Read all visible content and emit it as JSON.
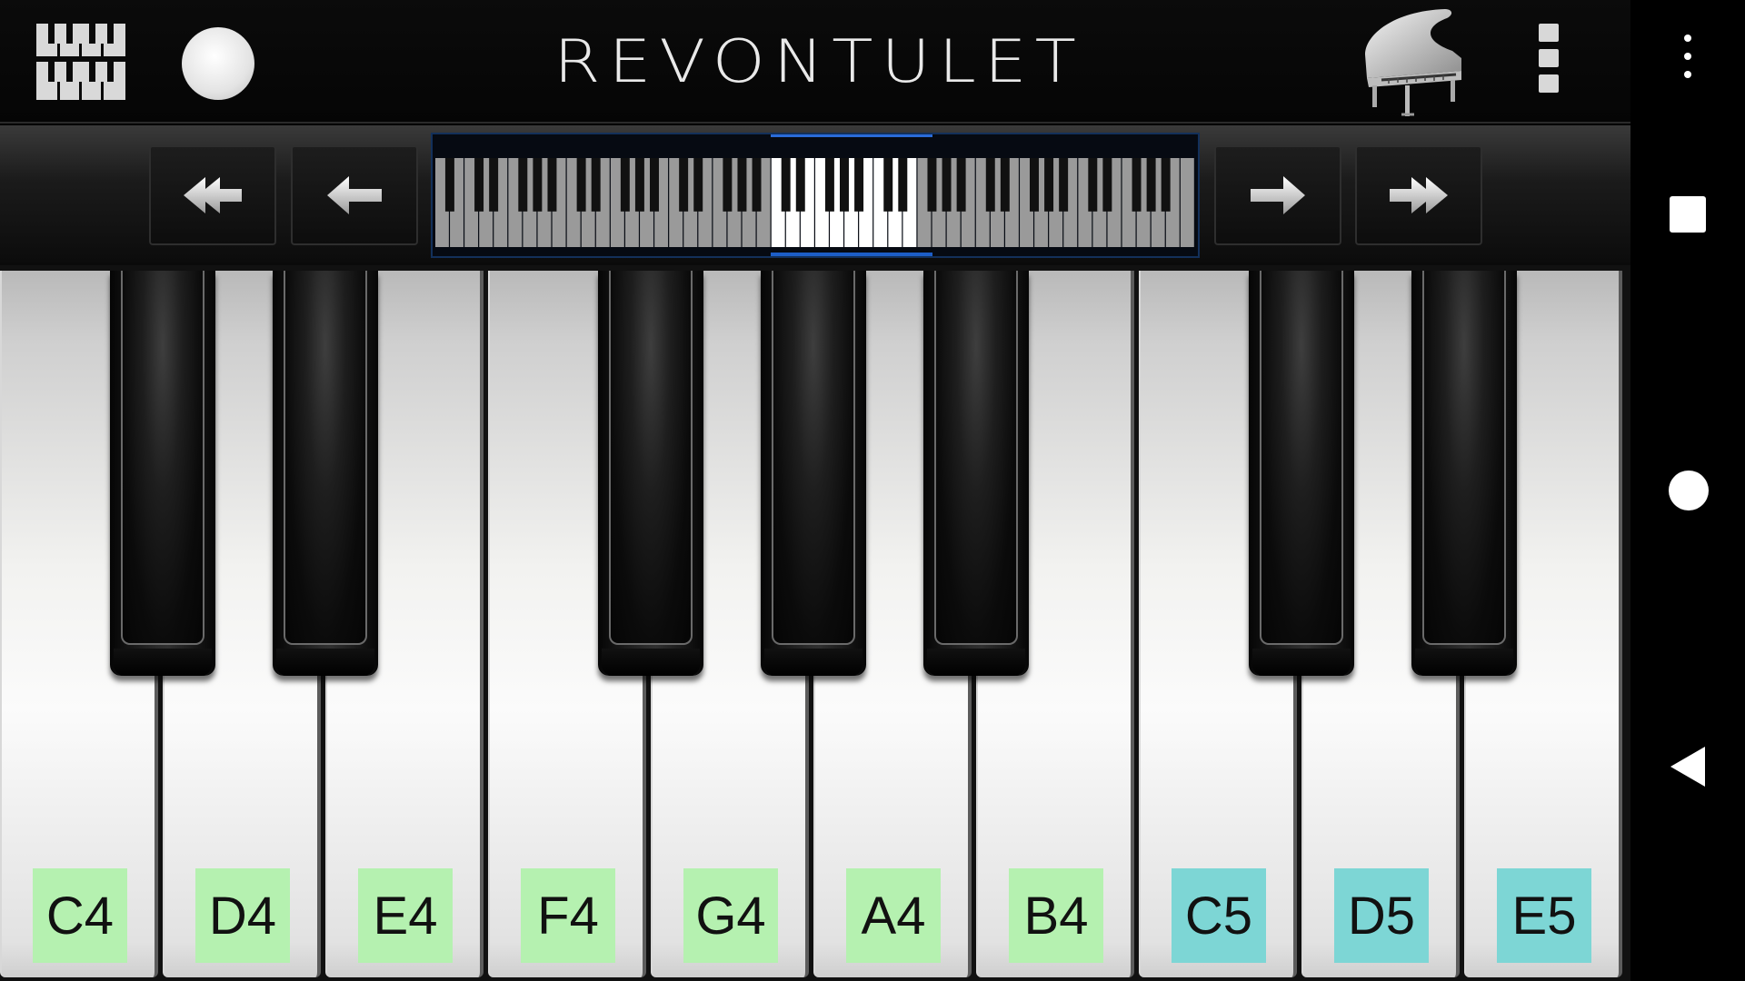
{
  "app": {
    "title": "REVONTULET"
  },
  "toolbar": {
    "left_icon": "keyboard-layout-icon",
    "record_icon": "record-icon",
    "instrument_icon": "grand-piano-icon",
    "menu_icon": "vertical-menu-icon"
  },
  "navigation": {
    "buttons": [
      {
        "icon": "double-arrow-left-icon"
      },
      {
        "icon": "arrow-left-icon"
      },
      {
        "icon": "arrow-right-icon"
      },
      {
        "icon": "double-arrow-right-icon"
      }
    ],
    "overview": {
      "total_white_keys": 52,
      "visible_range": "C4-E5"
    }
  },
  "keyboard": {
    "white_keys": [
      {
        "note": "C4",
        "label_color": "#b5f1b0"
      },
      {
        "note": "D4",
        "label_color": "#b5f1b0"
      },
      {
        "note": "E4",
        "label_color": "#b5f1b0"
      },
      {
        "note": "F4",
        "label_color": "#b5f1b0"
      },
      {
        "note": "G4",
        "label_color": "#b5f1b0"
      },
      {
        "note": "A4",
        "label_color": "#b5f1b0"
      },
      {
        "note": "B4",
        "label_color": "#b5f1b0"
      },
      {
        "note": "C5",
        "label_color": "#7dd6d5"
      },
      {
        "note": "D5",
        "label_color": "#7dd6d5"
      },
      {
        "note": "E5",
        "label_color": "#7dd6d5"
      }
    ],
    "black_keys": [
      "C#4",
      "D#4",
      "F#4",
      "G#4",
      "A#4",
      "C#5",
      "D#5"
    ]
  },
  "system_nav": {
    "menu_icon": "overflow-menu-icon",
    "recent_icon": "recent-apps-icon",
    "home_icon": "home-icon",
    "back_icon": "back-icon"
  }
}
